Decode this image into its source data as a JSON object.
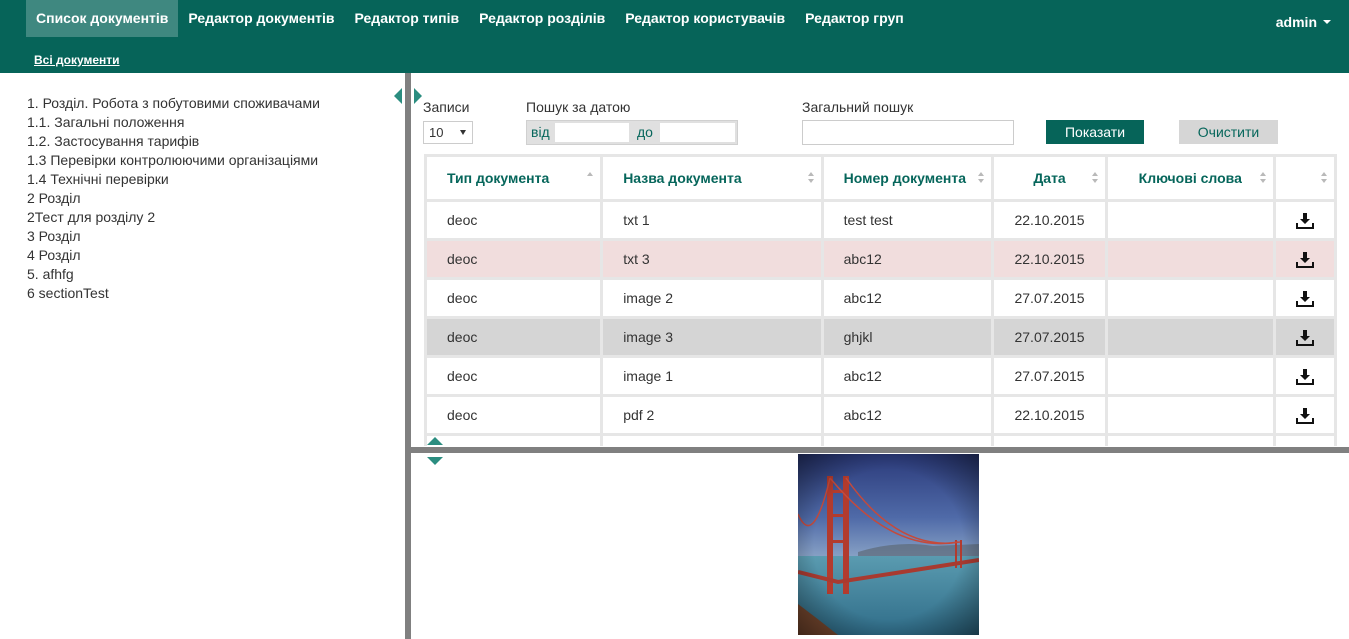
{
  "nav": {
    "items": [
      {
        "label": "Список документів",
        "active": true
      },
      {
        "label": "Редактор документів",
        "active": false
      },
      {
        "label": "Редактор типів",
        "active": false
      },
      {
        "label": "Редактор розділів",
        "active": false
      },
      {
        "label": "Редактор користувачів",
        "active": false
      },
      {
        "label": "Редактор груп",
        "active": false
      }
    ],
    "user": "admin",
    "sub_link": "Всі документи"
  },
  "sections": [
    "1. Розділ. Робота з побутовими споживачами",
    "1.1. Загальні положення",
    "1.2. Застосування тарифів",
    "1.3 Перевірки контролюючими організаціями",
    "1.4 Технічні перевірки",
    "2 Розділ",
    "2Тест для розділу 2",
    "3 Розділ",
    "4 Розділ",
    "5. afhfg",
    "6 sectionTest"
  ],
  "filters": {
    "records_label": "Записи",
    "records_value": "10",
    "date_label": "Пошук за датою",
    "from_label": "від",
    "to_label": "до",
    "search_label": "Загальний пошук",
    "show_button": "Показати",
    "clear_button": "Очистити"
  },
  "table": {
    "columns": [
      "Тип документа",
      "Назва документа",
      "Номер документа",
      "Дата",
      "Ключові слова"
    ],
    "rows": [
      {
        "type": "deoc",
        "name": "txt 1",
        "number": "test test",
        "date": "22.10.2015",
        "keywords": ""
      },
      {
        "type": "deoc",
        "name": "txt 3",
        "number": "abc12",
        "date": "22.10.2015",
        "keywords": ""
      },
      {
        "type": "deoc",
        "name": "image 2",
        "number": "abc12",
        "date": "27.07.2015",
        "keywords": ""
      },
      {
        "type": "deoc",
        "name": "image 3",
        "number": "ghjkl",
        "date": "27.07.2015",
        "keywords": ""
      },
      {
        "type": "deoc",
        "name": "image 1",
        "number": "abc12",
        "date": "27.07.2015",
        "keywords": ""
      },
      {
        "type": "deoc",
        "name": "pdf 2",
        "number": "abc12",
        "date": "22.10.2015",
        "keywords": ""
      }
    ]
  },
  "colors": {
    "primary": "#066459",
    "active_nav": "#3f8880",
    "accent_arrow": "#2b8d80",
    "highlight_row": "#f1dddd",
    "selected_row": "#d5d5d5",
    "splitter": "#808080"
  }
}
